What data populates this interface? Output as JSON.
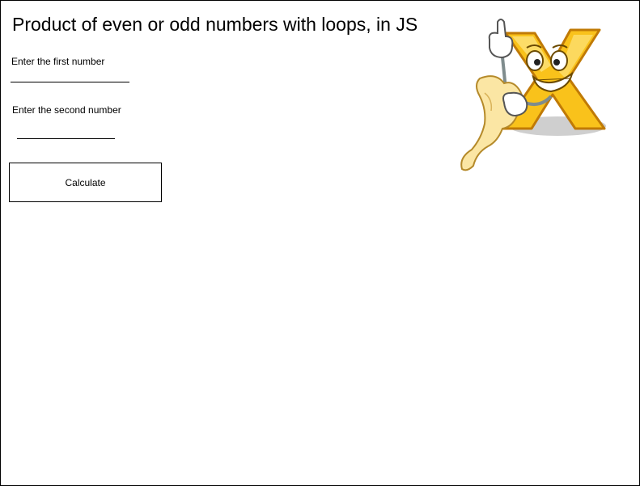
{
  "page": {
    "title": "Product of even or odd numbers with loops, in JS"
  },
  "form": {
    "first_label": "Enter the first number",
    "first_value": "",
    "second_label": "Enter the second number",
    "second_value": "",
    "calculate_label": "Calculate"
  },
  "mascot": {
    "icon": "x-letter-mascot-with-menu-icon",
    "colors": {
      "letter_fill": "#f9c21b",
      "letter_outline": "#c07a06",
      "paper": "#fbe6a4",
      "shadow": "#c8c8c8"
    }
  }
}
